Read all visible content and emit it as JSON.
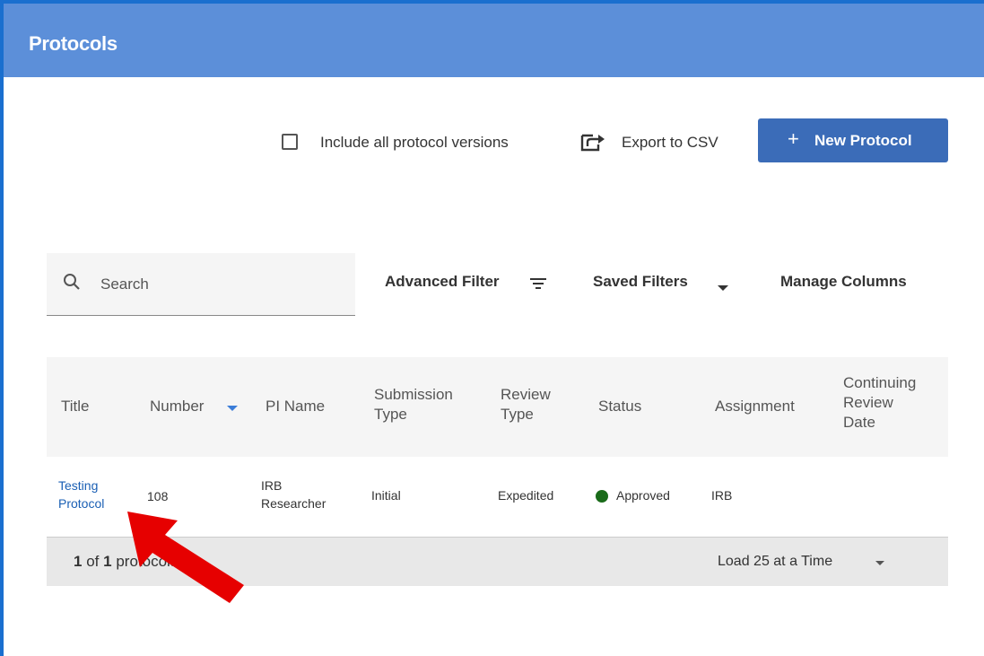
{
  "header": {
    "title": "Protocols"
  },
  "toolbar": {
    "include_versions_label": "Include all protocol versions",
    "export_label": "Export to CSV",
    "new_protocol_label": "New Protocol",
    "new_protocol_icon": "plus-icon"
  },
  "search": {
    "placeholder": "Search",
    "icon": "search-icon"
  },
  "filters": {
    "advanced_filter_label": "Advanced Filter",
    "saved_filters_label": "Saved Filters",
    "manage_columns_label": "Manage Columns"
  },
  "table": {
    "columns": {
      "title": "Title",
      "number": "Number",
      "pi_name": "PI Name",
      "submission_type_1": "Submission",
      "submission_type_2": "Type",
      "review_type_1": "Review",
      "review_type_2": "Type",
      "status": "Status",
      "assignment": "Assignment",
      "continuing_1": "Continuing",
      "continuing_2": "Review",
      "continuing_3": "Date"
    },
    "rows": [
      {
        "title_1": "Testing",
        "title_2": "Protocol",
        "number": "108",
        "pi_name_1": "IRB",
        "pi_name_2": "Researcher",
        "submission_type": "Initial",
        "review_type": "Expedited",
        "status": "Approved",
        "status_color": "#1a6b1a",
        "assignment": "IRB",
        "continuing_review_date": ""
      }
    ],
    "footer": {
      "count_current": "1",
      "count_of": "of",
      "count_total": "1",
      "count_suffix": "protocols",
      "load_label": "Load 25 at a Time"
    }
  },
  "colors": {
    "header_bg": "#5c8fd9",
    "accent": "#3b6cb8",
    "annotation_arrow": "#e60000"
  }
}
